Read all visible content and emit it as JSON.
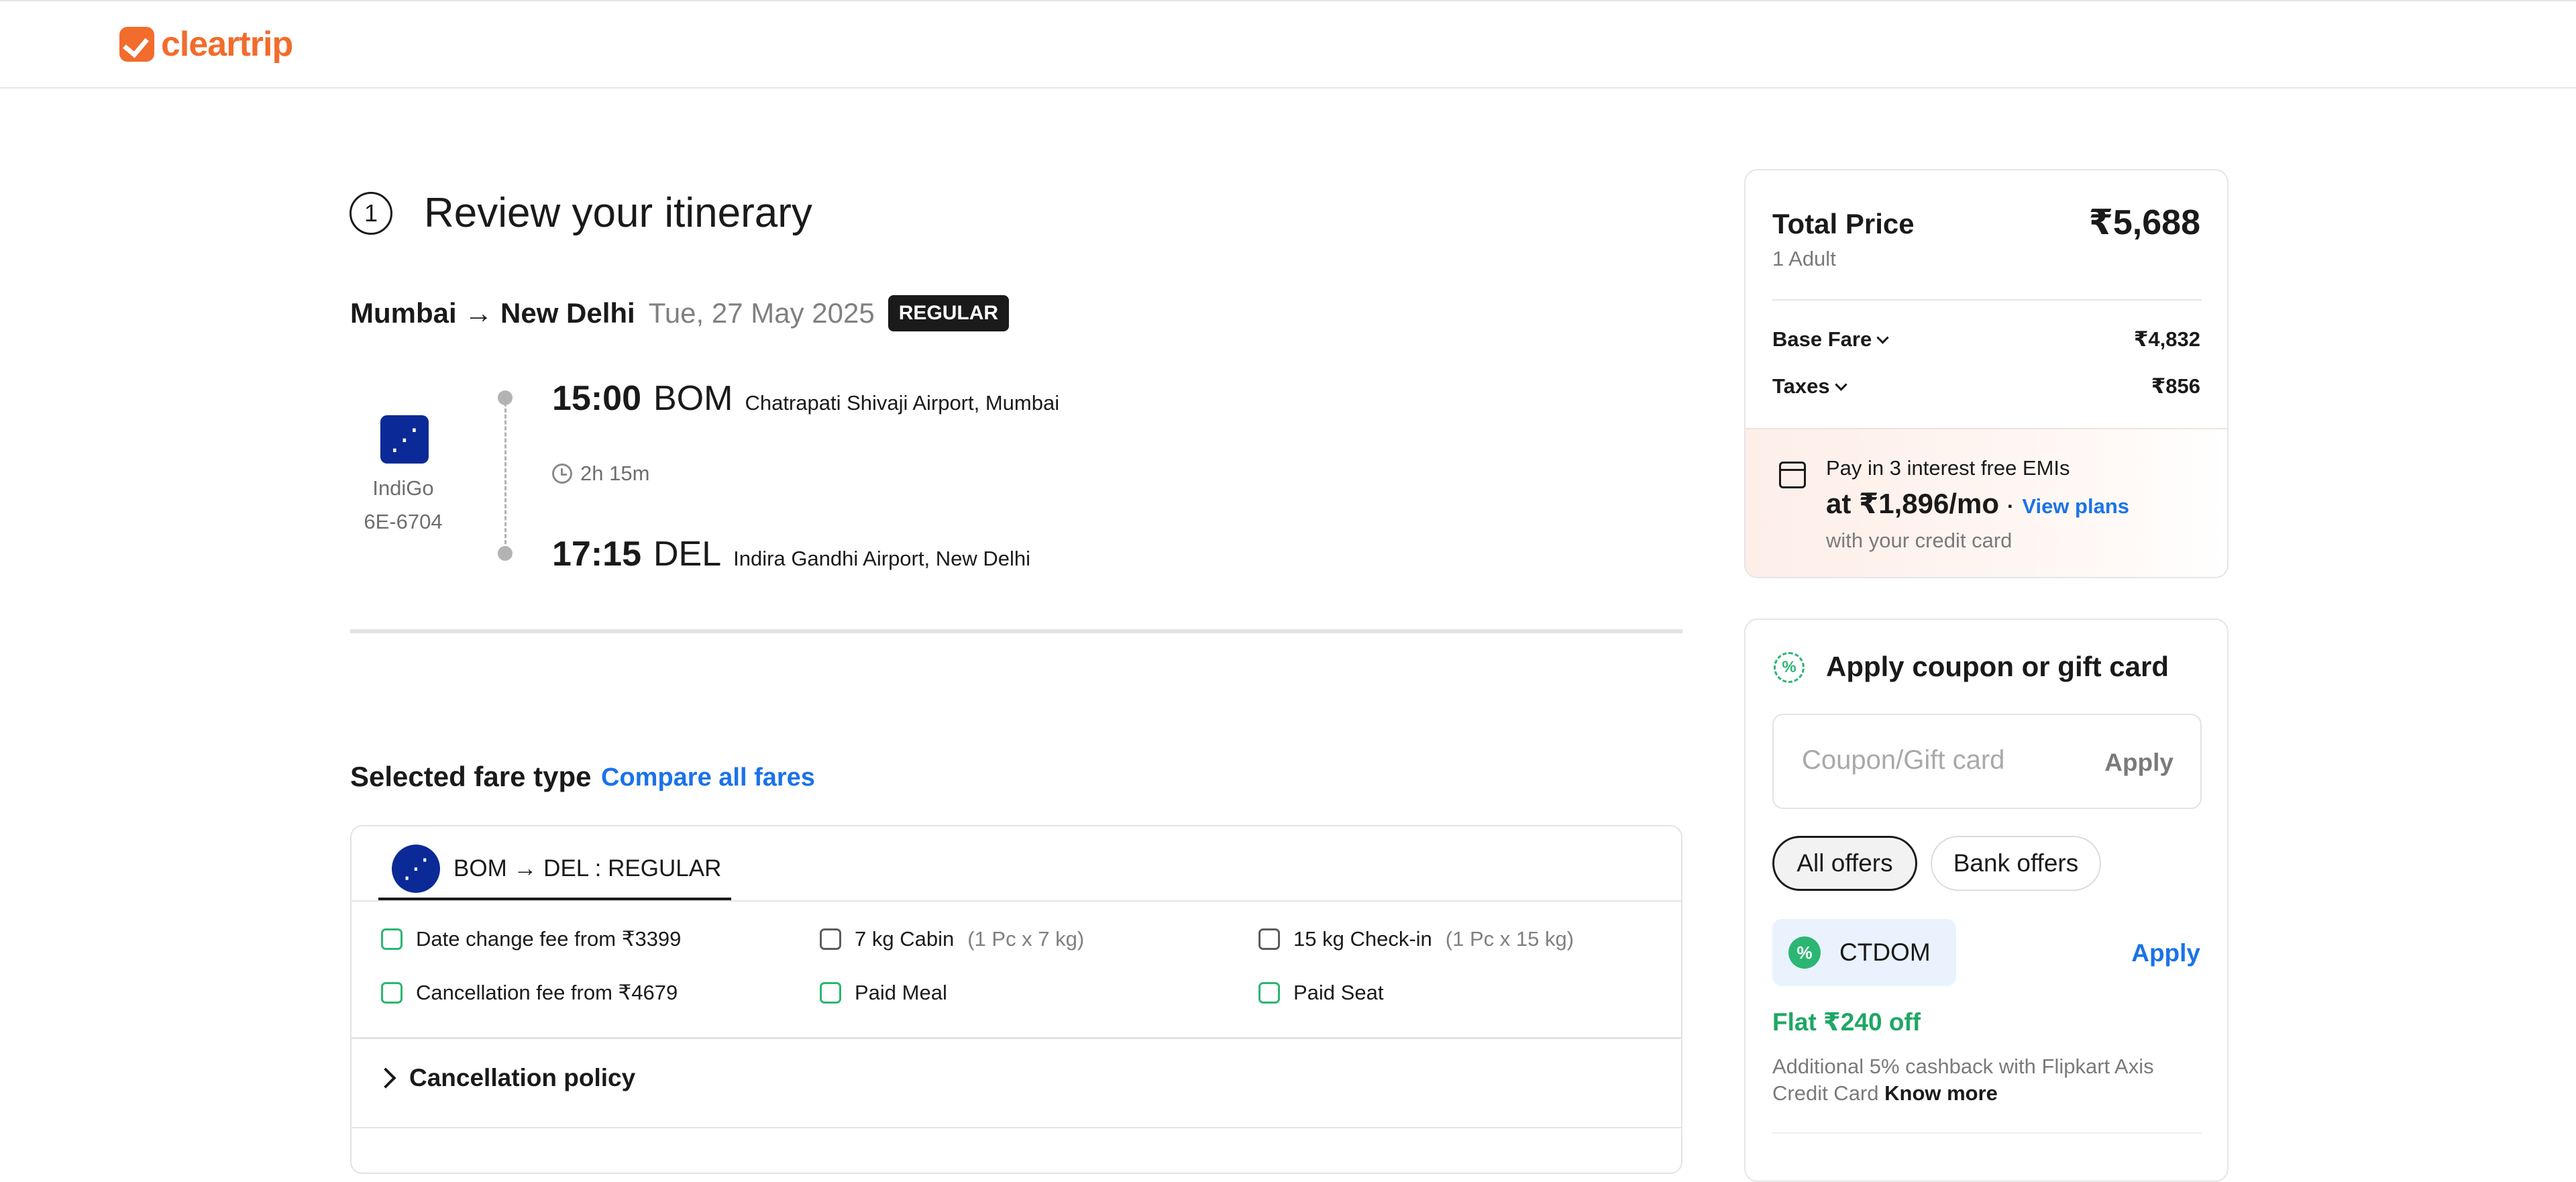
{
  "brand": {
    "name": "cleartrip",
    "color": "#f26c2c"
  },
  "step": {
    "number": "1",
    "title": "Review your itinerary"
  },
  "trip": {
    "route": "Mumbai → New Delhi",
    "date": "Tue, 27 May 2025",
    "fare_badge": "REGULAR"
  },
  "flight": {
    "airline": "IndiGo",
    "number": "6E-6704",
    "departure": {
      "time": "15:00",
      "code": "BOM",
      "airport": "Chatrapati Shivaji Airport, Mumbai"
    },
    "duration": "2h 15m",
    "arrival": {
      "time": "17:15",
      "code": "DEL",
      "airport": "Indira Gandhi Airport, New Delhi"
    }
  },
  "fare_section": {
    "title": "Selected fare type",
    "compare_link": "Compare all fares",
    "tab_label": "BOM → DEL : REGULAR",
    "features": [
      {
        "icon": "calendar-change-icon",
        "text": "Date change fee from ₹3399",
        "muted": ""
      },
      {
        "icon": "cabin-bag-icon",
        "text": "7 kg Cabin",
        "muted": "(1 Pc x 7 kg)"
      },
      {
        "icon": "checkin-bag-icon",
        "text": "15 kg Check-in",
        "muted": "(1 Pc x 15 kg)"
      },
      {
        "icon": "calendar-cancel-icon",
        "text": "Cancellation fee from ₹4679",
        "muted": ""
      },
      {
        "icon": "meal-icon",
        "text": "Paid Meal",
        "muted": ""
      },
      {
        "icon": "seat-icon",
        "text": "Paid Seat",
        "muted": ""
      }
    ],
    "cancellation_policy": "Cancellation policy"
  },
  "price": {
    "title": "Total Price",
    "total": "₹5,688",
    "travellers": "1 Adult",
    "base_fare_label": "Base Fare",
    "base_fare": "₹4,832",
    "taxes_label": "Taxes",
    "taxes": "₹856",
    "emi_line1": "Pay in 3 interest free EMIs",
    "emi_amount": "at ₹1,896/mo",
    "emi_dot": "·",
    "emi_link": "View plans",
    "emi_line3": "with your credit card"
  },
  "coupon": {
    "title": "Apply coupon or gift card",
    "placeholder": "Coupon/Gift card",
    "apply_label": "Apply",
    "tabs": [
      "All offers",
      "Bank offers"
    ],
    "offer": {
      "badge": "%",
      "code": "CTDOM",
      "apply": "Apply",
      "title": "Flat ₹240 off",
      "desc": "Additional 5% cashback with Flipkart Axis Credit Card",
      "know_more": "Know more"
    }
  }
}
